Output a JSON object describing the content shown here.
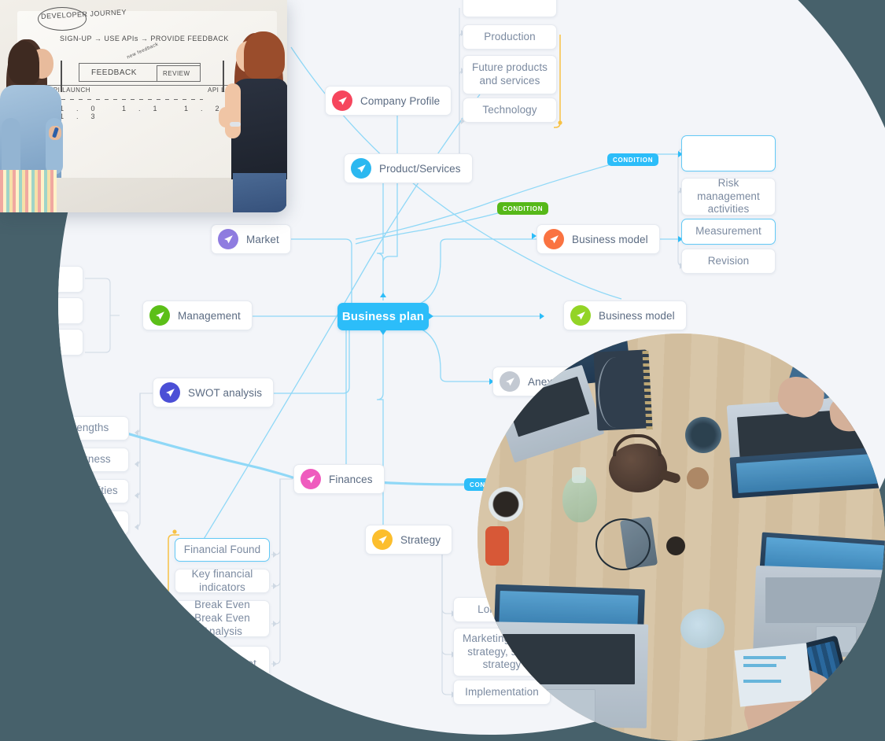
{
  "meta": {
    "title": "Business plan mind map",
    "background_color": "#47616b",
    "canvas_color": "#f3f5f9",
    "accent_color": "#2cbdf9"
  },
  "mindmap": {
    "root": {
      "label": "Business plan",
      "color": "#2cbdf9"
    },
    "branches": [
      {
        "label": "Company Profile",
        "icon": "paper-plane-icon",
        "color": "#f6465d"
      },
      {
        "label": "Product/Services",
        "icon": "paper-plane-icon",
        "color": "#2cb8f0"
      },
      {
        "label": "Market",
        "icon": "paper-plane-icon",
        "color": "#8f7ce0"
      },
      {
        "label": "Management",
        "icon": "paper-plane-icon",
        "color": "#5cbf18"
      },
      {
        "label": "SWOT analysis",
        "icon": "paper-plane-icon",
        "color": "#4b4fd6"
      },
      {
        "label": "Business model",
        "icon": "paper-plane-icon",
        "color": "#fa7341"
      },
      {
        "label": "Business model",
        "icon": "paper-plane-icon",
        "color": "#93d426"
      },
      {
        "label": "Anexes",
        "icon": "paper-plane-icon",
        "color": "#c3c9d2"
      },
      {
        "label": "Finances",
        "icon": "paper-plane-icon",
        "color": "#ef5bbe"
      },
      {
        "label": "Strategy",
        "icon": "paper-plane-icon",
        "color": "#fcbe2d"
      }
    ],
    "product_children": [
      {
        "label": "Production"
      },
      {
        "label": "Future products and services"
      },
      {
        "label": "Technology"
      }
    ],
    "business_model_children": [
      {
        "label": ""
      },
      {
        "label": "Risk management activities"
      },
      {
        "label": "Measurement"
      },
      {
        "label": "Revision"
      }
    ],
    "swot_children": [
      {
        "label": "Strengths"
      },
      {
        "label": "Weakness"
      },
      {
        "label": "Opportunities"
      },
      {
        "label": ""
      }
    ],
    "finance_children": [
      {
        "label": "Financial Found"
      },
      {
        "label": "Key financial indicators"
      },
      {
        "label": "Break Even Break Even Analysis"
      },
      {
        "label": "Balance sheet"
      }
    ],
    "strategy_children": [
      {
        "label": "Long term"
      },
      {
        "label": "Marketing, sales strategy, sales strategy"
      },
      {
        "label": "Implementation"
      }
    ],
    "badges": [
      {
        "label": "CONDITION",
        "color": "#2cbdf9"
      },
      {
        "label": "CONDITION",
        "color": "#56b819"
      },
      {
        "label": "CONDITION",
        "color": "#2cbdf9"
      }
    ]
  },
  "photos": {
    "top_left": {
      "alt": "Two women at a whiteboard discussing a developer journey diagram",
      "whiteboard": {
        "title": "DEVELOPER JOURNEY",
        "flow": "SIGN-UP  →  USE APIs  →  PROVIDE FEEDBACK",
        "box_left": "FEEDBACK",
        "box_right": "REVIEW",
        "marker_left": "API LAUNCH",
        "marker_right": "API LAUNCH",
        "ticks": "1.0   1.1   1.2   1.3"
      }
    },
    "bottom_right": {
      "alt": "Overhead view of a wooden desk with laptops, teapot, notebook and hands typing"
    }
  }
}
